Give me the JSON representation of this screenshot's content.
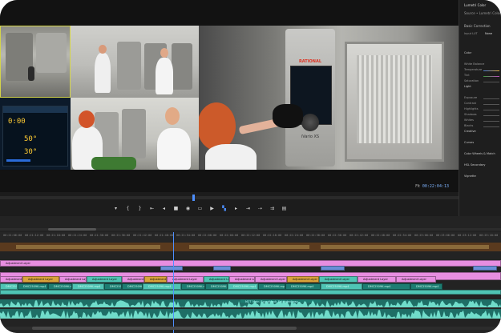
{
  "monitor": {
    "timecode": "00:22:04:13",
    "fit": "Fit",
    "rational_brand": "RATIONAL",
    "rational_model": "iVario XS",
    "panel_readouts": [
      "0:00",
      "50°",
      "30°"
    ]
  },
  "transport": [
    "marker",
    "in",
    "out",
    "go-in",
    "step-back",
    "play",
    "step-fwd",
    "go-out",
    "insert",
    "overwrite",
    "export-frame",
    "compare",
    "toggle",
    "settings",
    "add"
  ],
  "lumetri": {
    "title": "Lumetri Color",
    "source": "Source • Lumetri Color",
    "section": "Basic Correction",
    "input_lut_label": "Input LUT",
    "input_lut_value": "None",
    "rows": [
      {
        "label": "Color",
        "head": true
      },
      {
        "label": "White Balance",
        "head": false
      },
      {
        "label": "Temperature",
        "head": false,
        "slider": "warm"
      },
      {
        "label": "Tint",
        "head": false,
        "slider": "tint"
      },
      {
        "label": "Saturation",
        "head": false,
        "slider": "plain"
      },
      {
        "label": "Light",
        "head": true
      },
      {
        "label": "Exposure",
        "head": false,
        "slider": "plain"
      },
      {
        "label": "Contrast",
        "head": false,
        "slider": "plain"
      },
      {
        "label": "Highlights",
        "head": false,
        "slider": "plain"
      },
      {
        "label": "Shadows",
        "head": false,
        "slider": "plain"
      },
      {
        "label": "Whites",
        "head": false,
        "slider": "plain"
      },
      {
        "label": "Blacks",
        "head": false,
        "slider": "plain"
      },
      {
        "label": "Creative",
        "head": true
      },
      {
        "label": "Curves",
        "head": true
      },
      {
        "label": "Color Wheels & Match",
        "head": true
      },
      {
        "label": "HSL Secondary",
        "head": true
      },
      {
        "label": "Vignette",
        "head": true
      }
    ]
  },
  "timeline": {
    "ruler_ticks": [
      "00:21:06:00",
      "00:21:12:00",
      "00:21:18:00",
      "00:21:24:00",
      "00:21:30:00",
      "00:21:36:00",
      "00:21:42:00",
      "00:21:48:00",
      "00:21:54:00",
      "00:22:00:00",
      "00:22:06:00",
      "00:22:12:00",
      "00:22:18:00",
      "00:22:24:00",
      "00:22:30:00",
      "00:22:36:00",
      "00:22:42:00",
      "00:22:48:00",
      "00:22:54:00",
      "00:23:00:00",
      "00:23:06:00",
      "00:23:12:00",
      "00:23:18:00"
    ],
    "adjustment_label": "Adjustment Layer",
    "clip_label": "DMC2509K.mp4",
    "audio_label": "M2T_Main_Soundtrack_Extended.wav"
  }
}
